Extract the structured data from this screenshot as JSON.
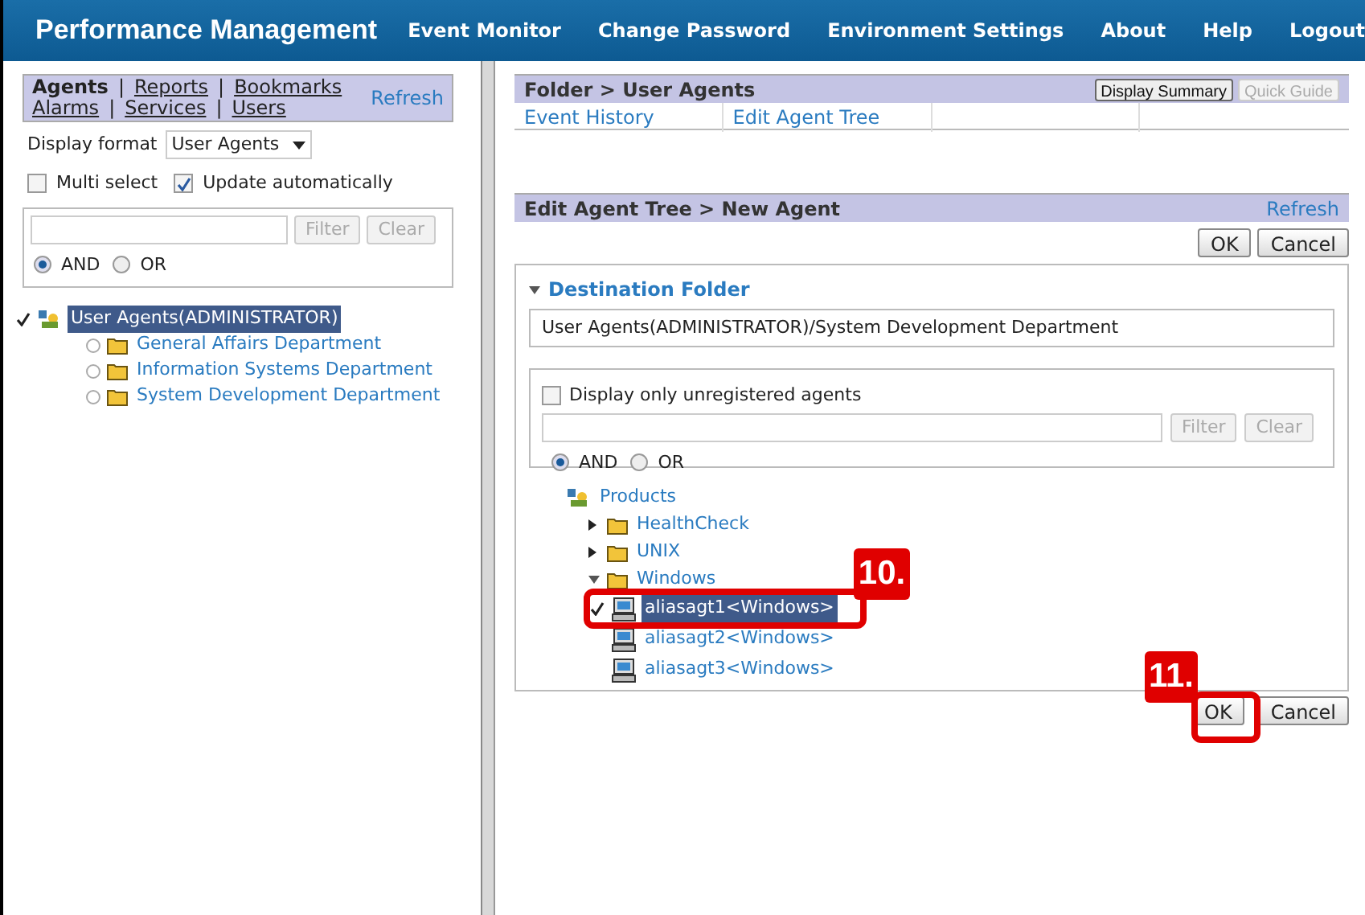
{
  "header": {
    "title": "Performance Management",
    "nav": [
      "Event Monitor",
      "Change Password",
      "Environment Settings",
      "About",
      "Help",
      "Logout"
    ]
  },
  "left": {
    "tab_rows": [
      [
        {
          "label": "Agents",
          "selected": true
        },
        {
          "label": "Reports",
          "selected": false
        },
        {
          "label": "Bookmarks",
          "selected": false
        }
      ],
      [
        {
          "label": "Alarms",
          "selected": false
        },
        {
          "label": "Services",
          "selected": false
        },
        {
          "label": "Users",
          "selected": false
        }
      ]
    ],
    "separator": "|",
    "refresh": "Refresh",
    "display_format": {
      "label": "Display format",
      "value": "User Agents"
    },
    "options": [
      {
        "label": "Multi select",
        "checked": false
      },
      {
        "label": "Update automatically",
        "checked": true
      }
    ],
    "filter": {
      "buttons": [
        "Filter",
        "Clear"
      ],
      "radios": [
        {
          "label": "AND",
          "selected": true
        },
        {
          "label": "OR",
          "selected": false
        }
      ]
    },
    "tree": [
      {
        "label": "User Agents(ADMINISTRATOR)",
        "kind": "root",
        "selected": true,
        "checked": true,
        "children": [
          {
            "label": "General Affairs Department",
            "kind": "folder",
            "selected": false,
            "checked": false
          },
          {
            "label": "Information Systems Department",
            "kind": "folder",
            "selected": false,
            "checked": false
          },
          {
            "label": "System Development Department",
            "kind": "folder",
            "selected": false,
            "checked": false
          }
        ]
      }
    ]
  },
  "right": {
    "folder_title": "Folder > User Agents",
    "folder_buttons": [
      {
        "label": "Display Summary",
        "disabled": false
      },
      {
        "label": "Quick Guide",
        "disabled": true
      }
    ],
    "links": [
      "Event History",
      "Edit Agent Tree"
    ],
    "edit_title": "Edit Agent Tree > New Agent",
    "refresh": "Refresh",
    "top_buttons": [
      "OK",
      "Cancel"
    ],
    "destination": {
      "label": "Destination Folder",
      "expanded": true,
      "path": "User Agents(ADMINISTRATOR)/System Development Department"
    },
    "unregistered": {
      "label": "Display only unregistered agents",
      "checked": false
    },
    "filter": {
      "buttons": [
        "Filter",
        "Clear"
      ],
      "radios": [
        {
          "label": "AND",
          "selected": true
        },
        {
          "label": "OR",
          "selected": false
        }
      ]
    },
    "tree": [
      {
        "label": "Products",
        "kind": "root",
        "selected": false,
        "checked": false,
        "children": [
          {
            "label": "HealthCheck",
            "kind": "folder",
            "expanded": false,
            "selected": false,
            "checked": false
          },
          {
            "label": "UNIX",
            "kind": "folder",
            "expanded": false,
            "selected": false,
            "checked": false
          },
          {
            "label": "Windows",
            "kind": "folder",
            "expanded": true,
            "selected": false,
            "checked": false,
            "children": [
              {
                "label": "aliasagt1<Windows>",
                "kind": "agent",
                "selected": true,
                "checked": true
              },
              {
                "label": "aliasagt2<Windows>",
                "kind": "agent",
                "selected": false,
                "checked": false
              },
              {
                "label": "aliasagt3<Windows>",
                "kind": "agent",
                "selected": false,
                "checked": false
              }
            ]
          }
        ]
      }
    ],
    "bottom_buttons": [
      "OK",
      "Cancel"
    ]
  },
  "callouts": [
    "10.",
    "11."
  ]
}
